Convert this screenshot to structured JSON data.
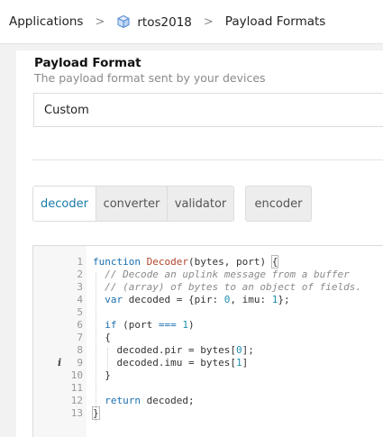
{
  "breadcrumb": {
    "items": [
      "Applications",
      "rtos2018",
      "Payload Formats"
    ],
    "separator": ">",
    "app_icon": "cube-icon"
  },
  "payload_format": {
    "title": "Payload Format",
    "subtitle": "The payload format sent by your devices",
    "selected": "Custom"
  },
  "tabs": {
    "active": "decoder",
    "items": [
      "decoder",
      "converter",
      "validator"
    ],
    "encoder_label": "encoder"
  },
  "editor": {
    "language": "javascript",
    "lines": [
      {
        "n": "1",
        "tokens": [
          [
            "kw",
            "function"
          ],
          [
            "p",
            " "
          ],
          [
            "fn",
            "Decoder"
          ],
          [
            "p",
            "(bytes, port) "
          ],
          [
            "hl",
            "{"
          ]
        ]
      },
      {
        "n": "2",
        "tokens": [
          [
            "p",
            "  "
          ],
          [
            "cm",
            "// Decode an uplink message from a buffer"
          ]
        ]
      },
      {
        "n": "3",
        "tokens": [
          [
            "p",
            "  "
          ],
          [
            "cm",
            "// (array) of bytes to an object of fields."
          ]
        ]
      },
      {
        "n": "4",
        "tokens": [
          [
            "p",
            "  "
          ],
          [
            "kw",
            "var"
          ],
          [
            "p",
            " decoded = {pir: "
          ],
          [
            "num",
            "0"
          ],
          [
            "p",
            ", imu: "
          ],
          [
            "num",
            "1"
          ],
          [
            "p",
            "};"
          ]
        ]
      },
      {
        "n": "5",
        "tokens": []
      },
      {
        "n": "6",
        "tokens": [
          [
            "p",
            "  "
          ],
          [
            "kw",
            "if"
          ],
          [
            "p",
            " (port "
          ],
          [
            "kw",
            "==="
          ],
          [
            "p",
            " "
          ],
          [
            "num",
            "1"
          ],
          [
            "p",
            ")"
          ]
        ]
      },
      {
        "n": "7",
        "tokens": [
          [
            "p",
            "  {"
          ]
        ]
      },
      {
        "n": "8",
        "tokens": [
          [
            "p",
            "    decoded.pir = bytes["
          ],
          [
            "num",
            "0"
          ],
          [
            "p",
            "];"
          ]
        ]
      },
      {
        "n": "9",
        "tokens": [
          [
            "p",
            "    decoded.imu = bytes["
          ],
          [
            "num",
            "1"
          ],
          [
            "p",
            "]"
          ]
        ],
        "marker": "i"
      },
      {
        "n": "10",
        "tokens": [
          [
            "p",
            "  }"
          ]
        ]
      },
      {
        "n": "11",
        "tokens": []
      },
      {
        "n": "12",
        "tokens": [
          [
            "p",
            "  "
          ],
          [
            "kw",
            "return"
          ],
          [
            "p",
            " decoded;"
          ]
        ]
      },
      {
        "n": "13",
        "tokens": [
          [
            "hl",
            "}"
          ]
        ]
      }
    ],
    "colors": {
      "keyword": "#1a6fb0",
      "function": "#b0452a",
      "comment": "#8a8a8a",
      "number": "#1e8fb0"
    }
  }
}
